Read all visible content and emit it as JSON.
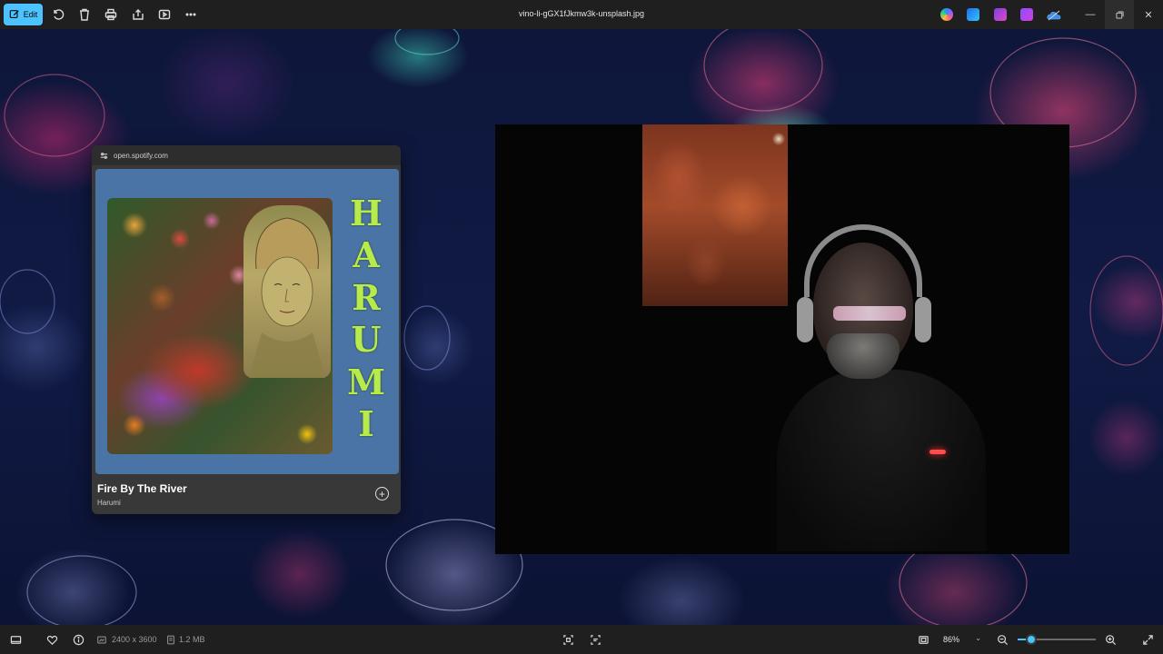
{
  "toolbar": {
    "edit_label": "Edit",
    "file_title": "vino-li-gGX1fJkmw3k-unsplash.jpg"
  },
  "spotify": {
    "url": "open.spotify.com",
    "album_title_art": "HARUMI",
    "track_title": "Fire By The River",
    "artist": "Harumi"
  },
  "statusbar": {
    "dimensions": "2400 x 3600",
    "file_size": "1.2 MB",
    "zoom": "86%",
    "zoom_fraction": 0.18
  },
  "colors": {
    "accent": "#4cc2ff",
    "chrome": "#1f1f1f",
    "album_bg": "#4b74a6",
    "title_art": "#b7ea4d"
  },
  "icons": {
    "toolbar": [
      "edit-icon",
      "rotate-icon",
      "delete-icon",
      "print-icon",
      "share-icon",
      "slideshow-icon",
      "more-icon"
    ],
    "apps": [
      "copilot-icon",
      "designer-icon",
      "clipchamp-icon",
      "photos-icon",
      "onedrive-icon"
    ],
    "window": [
      "minimize-icon",
      "restore-icon",
      "close-icon"
    ]
  }
}
